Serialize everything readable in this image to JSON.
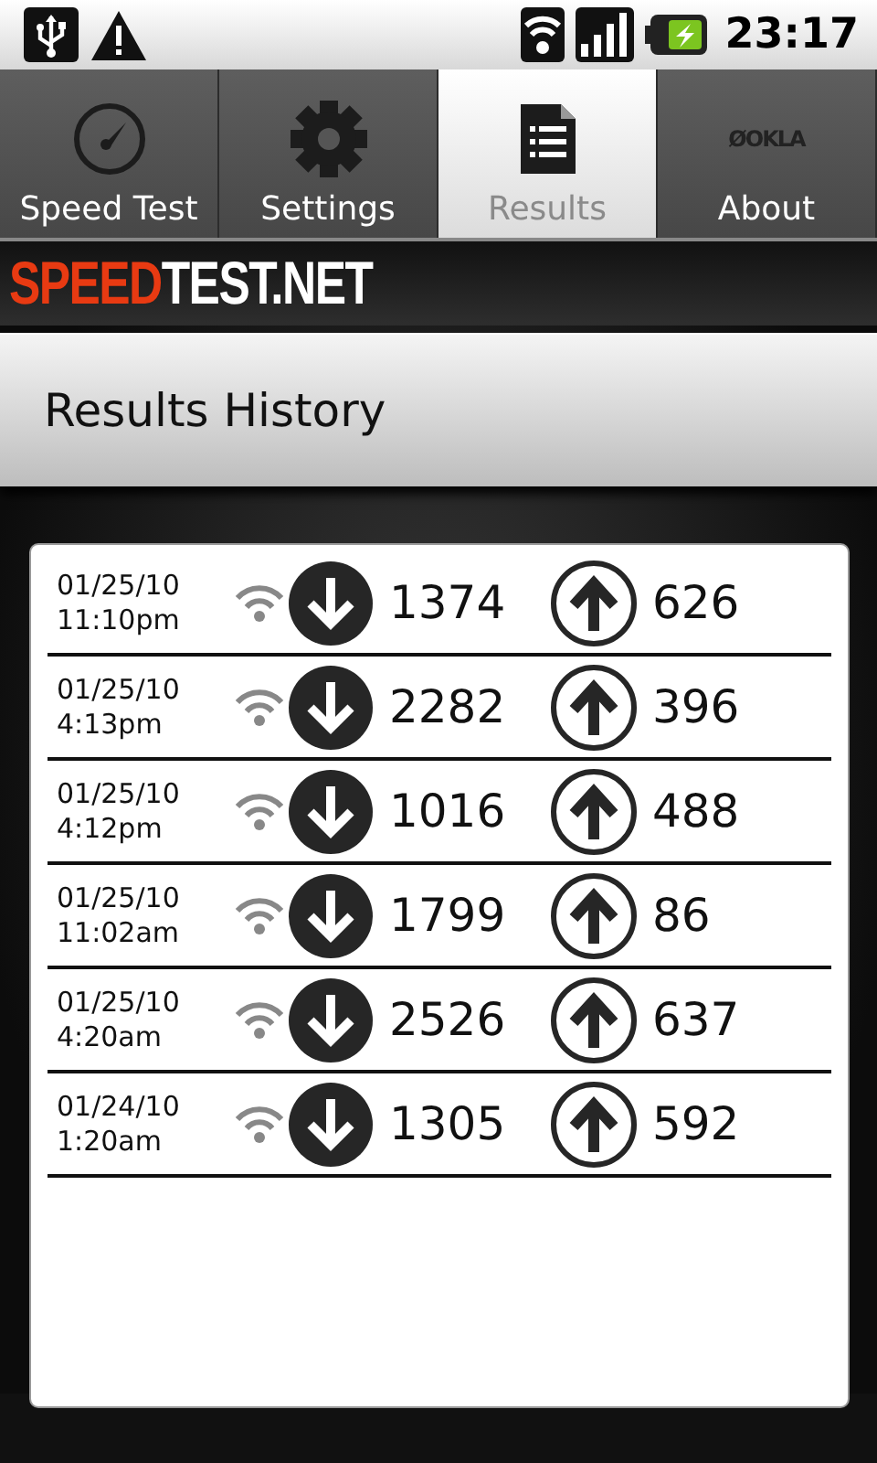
{
  "status_bar": {
    "time": "23:17"
  },
  "tabs": [
    {
      "label": "Speed Test",
      "selected": false
    },
    {
      "label": "Settings",
      "selected": false
    },
    {
      "label": "Results",
      "selected": true
    },
    {
      "label": "About",
      "logo_text": "ØOKLA",
      "selected": false
    }
  ],
  "brand": {
    "accent": "SPEED",
    "rest": "TEST.NET"
  },
  "header": {
    "title": "Results History"
  },
  "results": [
    {
      "date": "01/25/10",
      "time": "11:10pm",
      "download": "1374",
      "upload": "626"
    },
    {
      "date": "01/25/10",
      "time": "4:13pm",
      "download": "2282",
      "upload": "396"
    },
    {
      "date": "01/25/10",
      "time": "4:12pm",
      "download": "1016",
      "upload": "488"
    },
    {
      "date": "01/25/10",
      "time": "11:02am",
      "download": "1799",
      "upload": "86"
    },
    {
      "date": "01/25/10",
      "time": "4:20am",
      "download": "2526",
      "upload": "637"
    },
    {
      "date": "01/24/10",
      "time": "1:20am",
      "download": "1305",
      "upload": "592"
    }
  ]
}
